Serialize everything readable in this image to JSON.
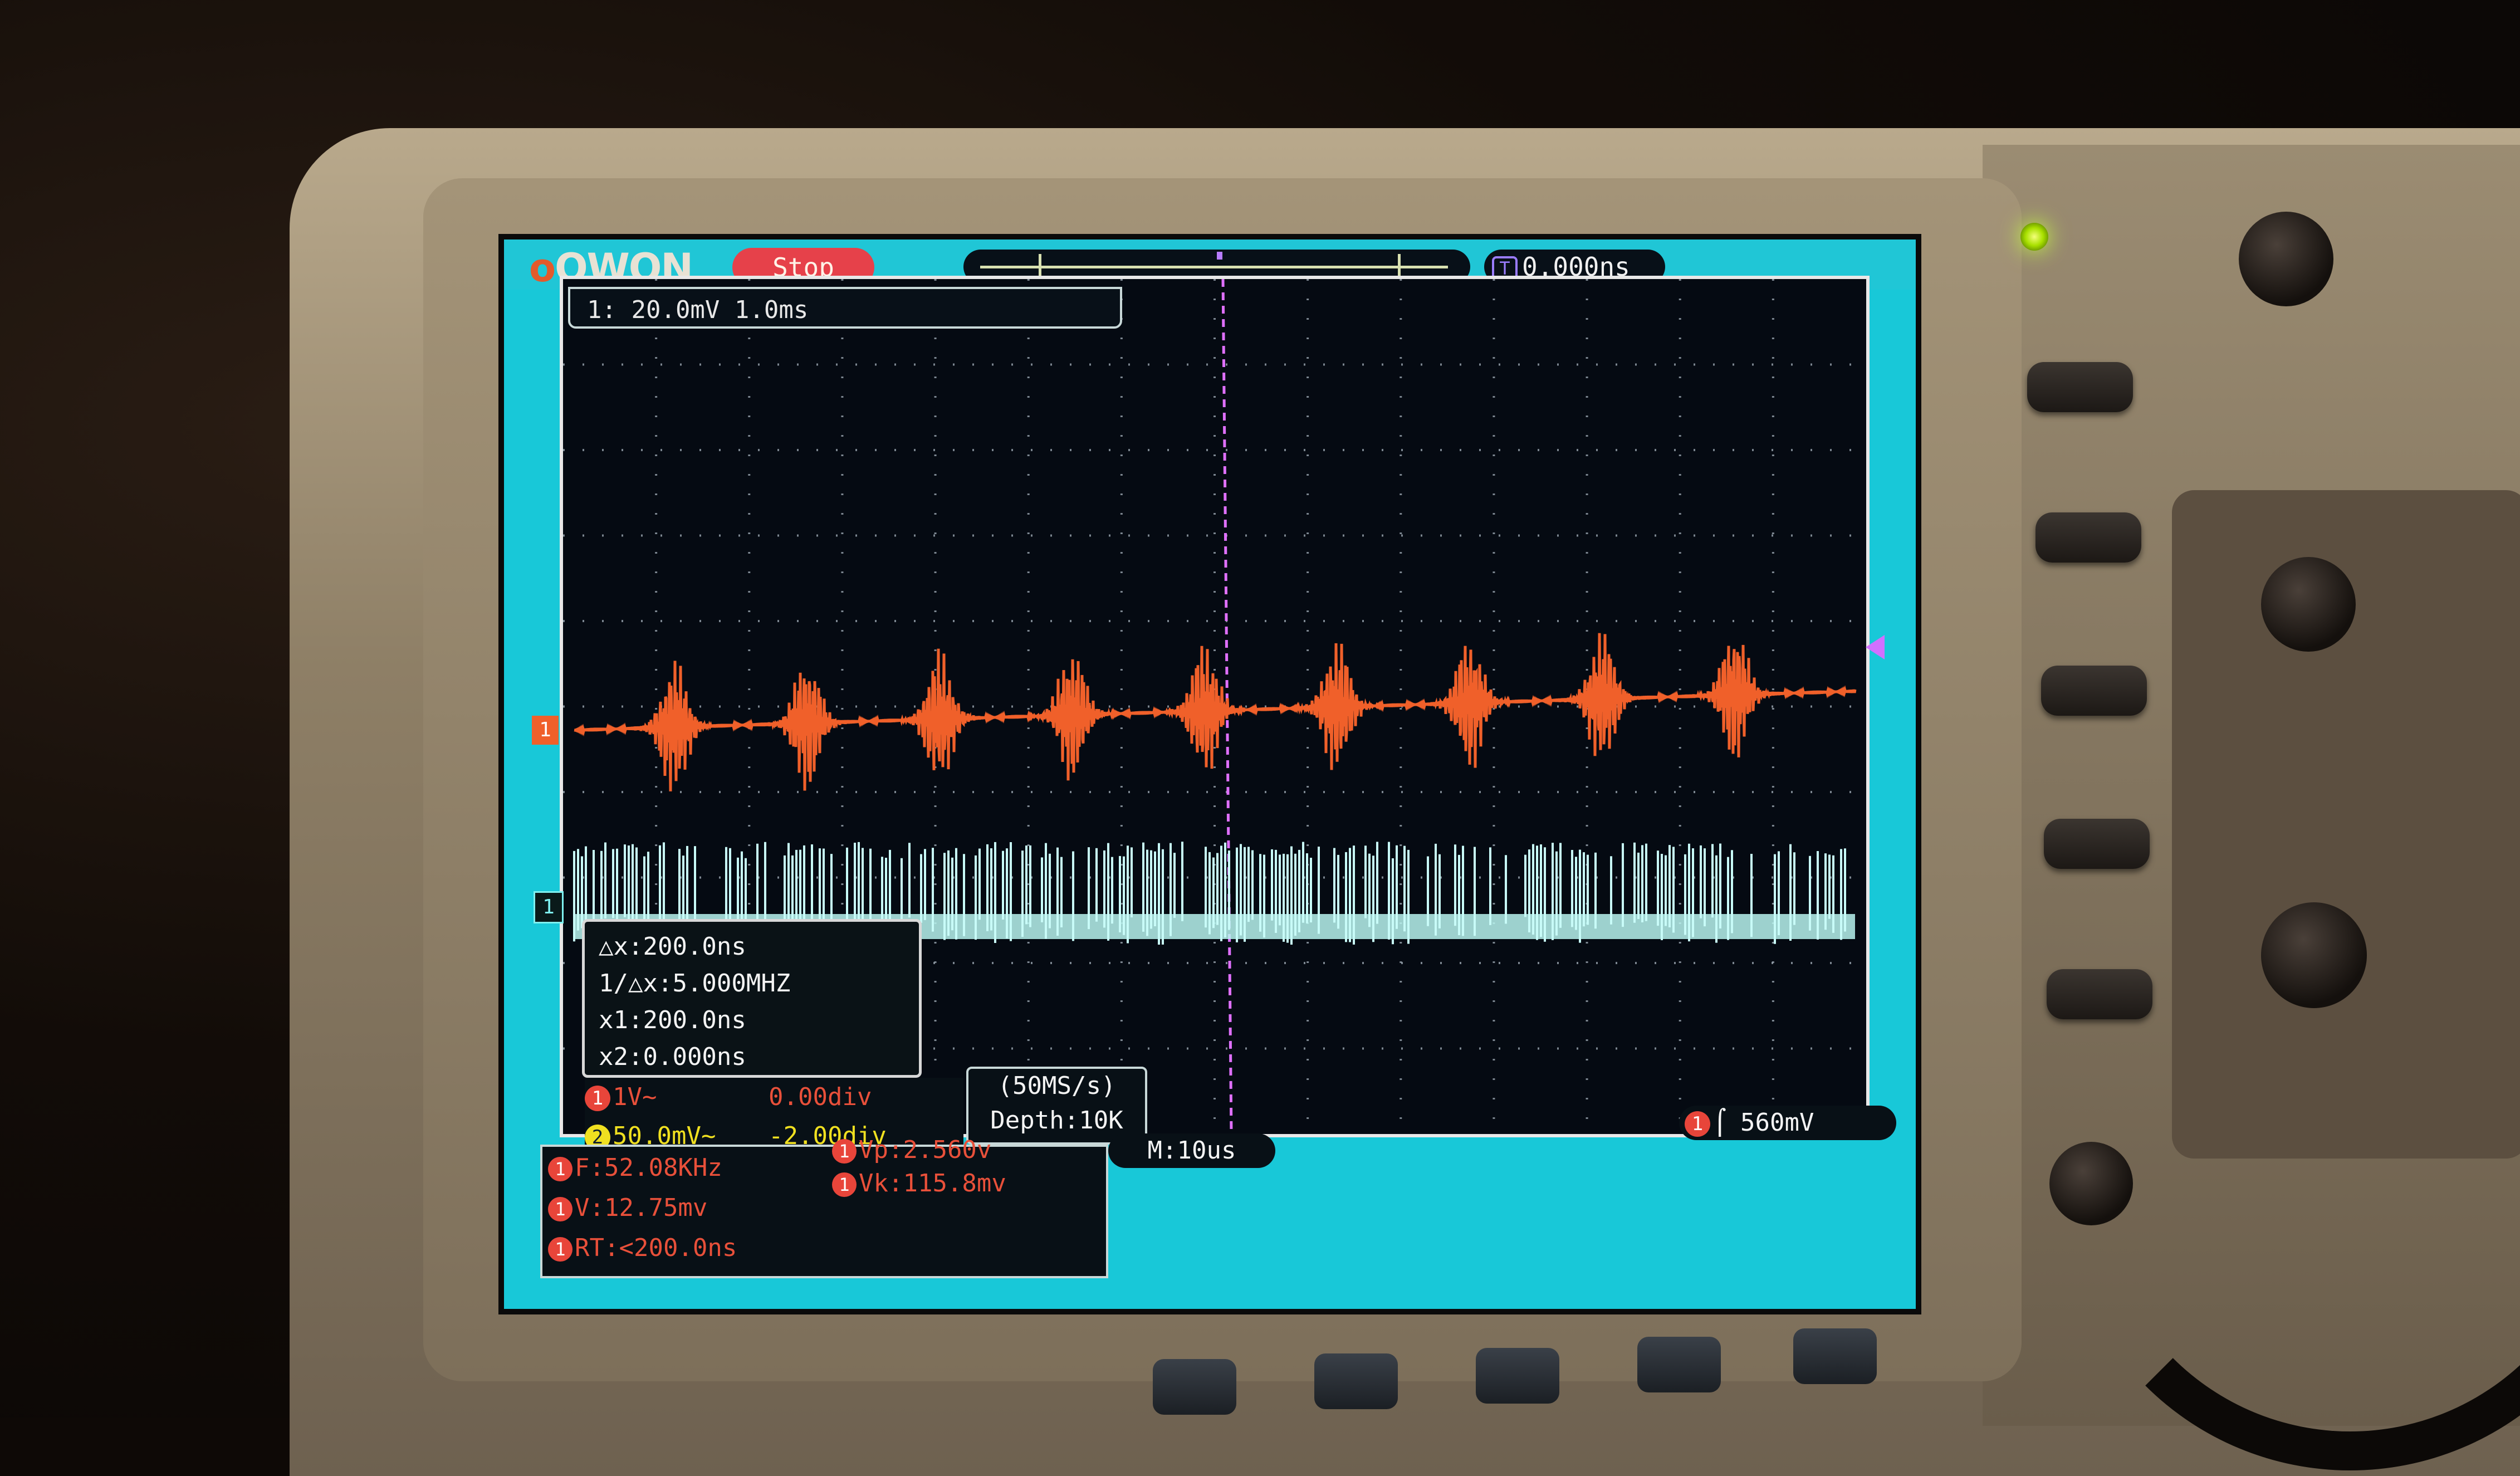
{
  "device": {
    "brand_logo": "OWON",
    "run_state": "Stop",
    "trigger_time": "0.000ns",
    "trigger_time_icon": "T",
    "colors": {
      "screen_bg": "#18c8d8",
      "graticule_bg": "#050a12",
      "ch1_trace": "#f0602a",
      "ch2_trace": "#b8f4f0",
      "stop_badge": "#e6414a",
      "led": "#b0ff30"
    }
  },
  "channel_info": "1: 20.0mV 1.0ms",
  "markers": {
    "ch1_label": "1",
    "ch2_label": "1"
  },
  "cursor": {
    "dx": "△x:200.0ns",
    "inv_dx": "1/△x:5.000MHZ",
    "x1": "x1:200.0ns",
    "x2": "x2:0.000ns"
  },
  "channels": [
    {
      "badge": "1",
      "scale": "1V~",
      "offset": "0.00div"
    },
    {
      "badge": "2",
      "scale": "50.0mV~",
      "offset": "-2.00div"
    }
  ],
  "acquisition": {
    "sample_rate": "(50MS/s)",
    "depth": "Depth:10K",
    "timebase": "M:10us"
  },
  "trigger": {
    "badge": "1",
    "level": "560mV"
  },
  "measurements": {
    "freq": {
      "badge": "1",
      "text": "F:52.08KHz"
    },
    "v": {
      "badge": "1",
      "text": "V:12.75mv"
    },
    "rt": {
      "badge": "1",
      "text": "RT:<200.0ns"
    },
    "vp": {
      "badge": "1",
      "text": "Vp:2.560v"
    },
    "vk": {
      "badge": "1",
      "text": "Vk:115.8mv"
    }
  },
  "traces": {
    "ch1_burst_count": 9,
    "ch1_baseline_div": 0,
    "ch2_offset_div": -2
  }
}
